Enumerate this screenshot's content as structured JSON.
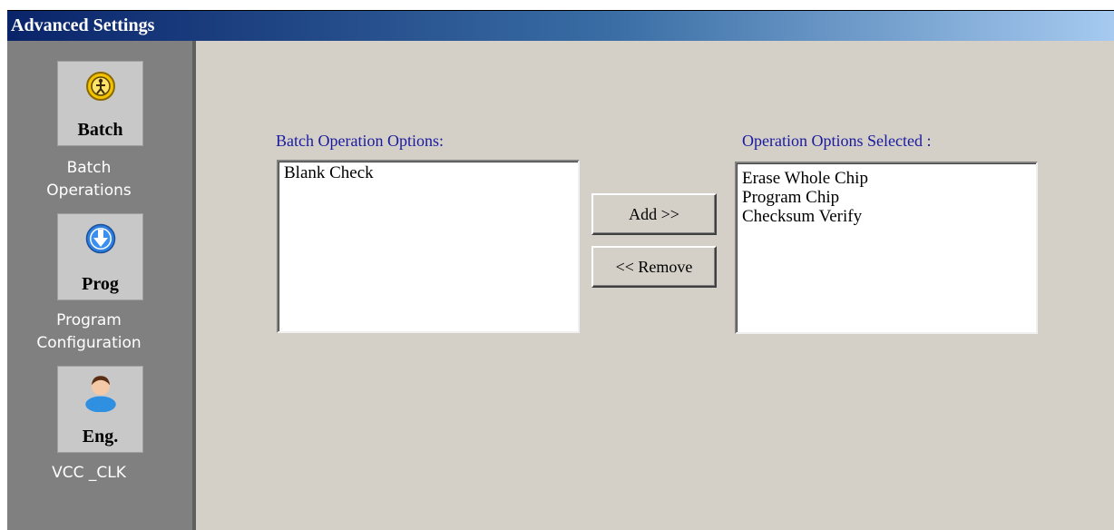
{
  "window": {
    "title": "Advanced Settings"
  },
  "sidebar": {
    "items": [
      {
        "code": "Batch",
        "caption_line1": "Batch",
        "caption_line2": "Operations",
        "icon": "batch-icon",
        "icon_color": "#e8b000"
      },
      {
        "code": "Prog",
        "caption_line1": "Program",
        "caption_line2": "Configuration",
        "icon": "download-arrow-icon",
        "icon_color": "#2d7fe0"
      },
      {
        "code": "Eng.",
        "caption_line1": "VCC _CLK",
        "caption_line2": "",
        "icon": "engineer-person-icon",
        "icon_color": "#2f8fe0"
      }
    ]
  },
  "main": {
    "available_label": "Batch Operation Options:",
    "available_items": [
      "Blank Check"
    ],
    "selected_label": "Operation Options Selected :",
    "selected_items": [
      "Erase Whole Chip",
      "Program Chip",
      "Checksum Verify"
    ],
    "add_button": "Add >>",
    "remove_button": "<< Remove"
  },
  "colors": {
    "titlebar_start": "#0a246a",
    "sidebar": "#808080",
    "content_bg": "#d4d0c8",
    "label_text": "#1a1aa0"
  }
}
